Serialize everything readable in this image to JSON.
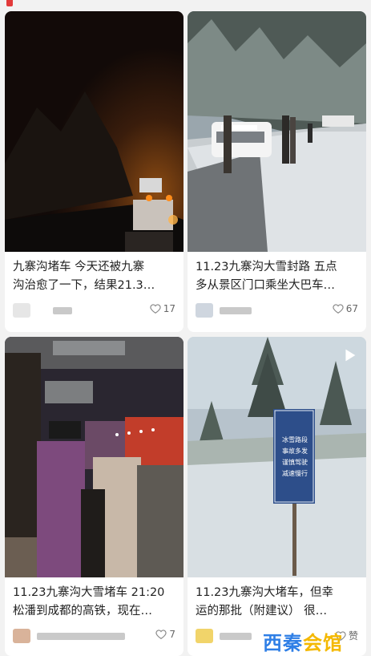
{
  "feed": {
    "cards": [
      {
        "title_line1": "九寨沟堵车 今天还被九寨",
        "title_line2": "沟治愈了一下，结果21.3…",
        "likes": "17",
        "photo": "night-highway-traffic-jam"
      },
      {
        "title_line1": "11.23九寨沟大雪封路 五点",
        "title_line2": "多从景区门口乘坐大巴车…",
        "likes": "67",
        "photo": "snowy-road-with-cars"
      },
      {
        "title_line1": "11.23九寨沟大雪堵车 21:20",
        "title_line2": "松潘到成都的高铁，现在…",
        "likes": "7",
        "photo": "bus-interior-night"
      },
      {
        "title_line1": "11.23九寨沟大堵车，但幸",
        "title_line2": "运的那批（附建议） 很…",
        "likes": "赞",
        "photo": "snowy-forest-with-sign"
      }
    ],
    "sign_text": [
      "冰雪路段",
      "事故多发",
      "谨慎驾驶",
      "减速慢行"
    ]
  },
  "watermark": {
    "part1": "西秦",
    "part2": "会馆"
  },
  "colors": {
    "accent": "#e23a3a",
    "watermark_blue": "#2f7fe6",
    "watermark_yellow": "#f4b800"
  }
}
